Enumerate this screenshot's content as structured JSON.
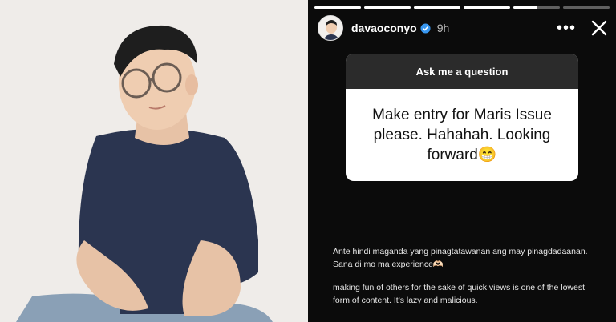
{
  "story": {
    "username": "davaoconyo",
    "time_ago": "9h",
    "more_glyph": "•••",
    "progress": [
      1,
      1,
      1,
      1,
      0.5,
      0
    ],
    "question_header": "Ask me a question",
    "question_text": "Make entry for Maris Issue please. Hahahah. Looking forward😁",
    "caption_1": "Ante hindi maganda yang pinagtatawanan ang may pinagdadaanan. Sana di mo ma experience🫶🏻",
    "caption_2": "making fun of others for the sake of quick views is one of the lowest form of content. It's lazy and malicious."
  },
  "icons": {
    "verified": "verified-badge-icon",
    "more": "more-options-icon",
    "close": "close-icon"
  },
  "colors": {
    "story_bg": "#0b0b0b",
    "question_header_bg": "#2b2b2b",
    "verified_blue": "#3897f0",
    "photo_bg": "#efece9"
  }
}
